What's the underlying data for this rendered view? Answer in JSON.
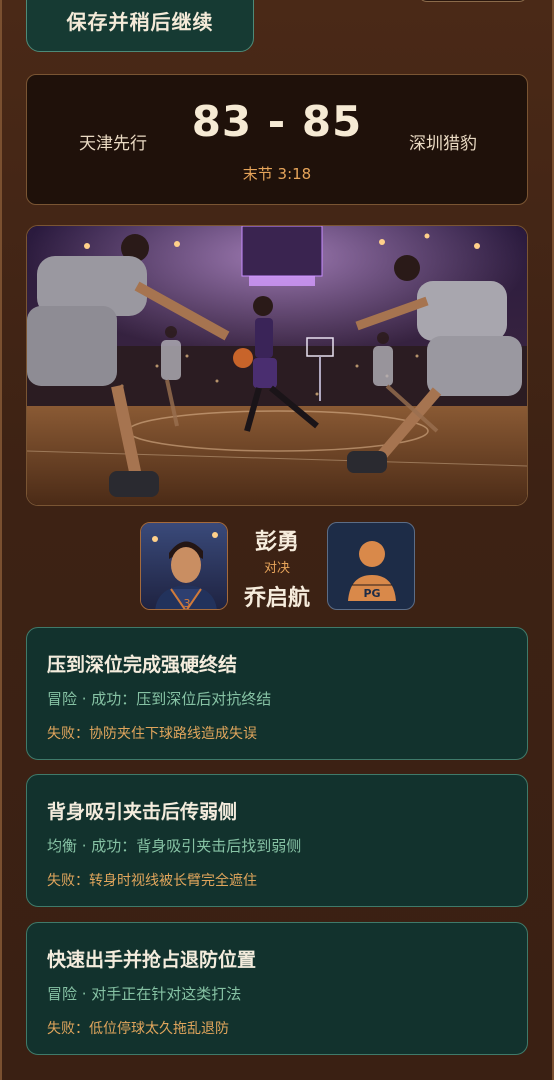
{
  "header": {
    "save_label": "保存并稍后继续"
  },
  "scoreboard": {
    "home_team": "天津先行",
    "away_team": "深圳猎豹",
    "score": "83 - 85",
    "clock": "末节 3:18"
  },
  "matchup": {
    "player": "彭勇",
    "versus": "对决",
    "opponent": "乔启航",
    "opponent_position": "PG"
  },
  "choices": [
    {
      "title": "压到深位完成强硬终结",
      "meta": "冒险 · 成功：压到深位后对抗终结",
      "fail": "失败：协防夹住下球路线造成失误"
    },
    {
      "title": "背身吸引夹击后传弱侧",
      "meta": "均衡 · 成功：背身吸引夹击后找到弱侧",
      "fail": "失败：转身时视线被长臂完全遮住"
    },
    {
      "title": "快速出手并抢占退防位置",
      "meta": "冒险 · 对手正在针对这类打法",
      "fail": "失败：低位停球太久拖乱退防"
    }
  ],
  "colors": {
    "accent": "#e6a45a",
    "card_bg": "#12322d",
    "card_border": "#3f7a6a",
    "page_bg": "#3d2214"
  }
}
